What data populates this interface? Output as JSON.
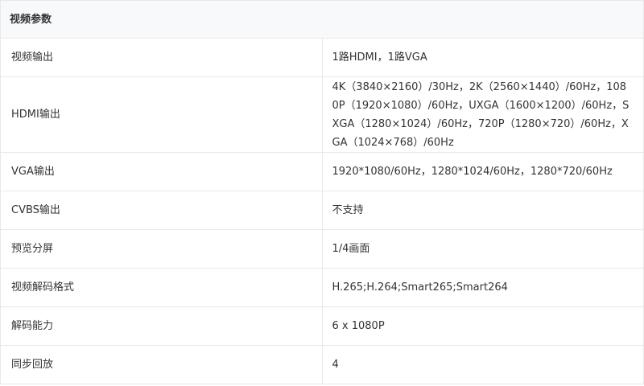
{
  "section": {
    "title": "视频参数"
  },
  "rows": [
    {
      "label": "视频输出",
      "value": "1路HDMI，1路VGA"
    },
    {
      "label": "HDMI输出",
      "value": "4K（3840×2160）/30Hz，2K（2560×1440）/60Hz，1080P（1920×1080）/60Hz，UXGA（1600×1200）/60Hz，SXGA（1280×1024）/60Hz，720P（1280×720）/60Hz，XGA（1024×768）/60Hz"
    },
    {
      "label": "VGA输出",
      "value": "1920*1080/60Hz，1280*1024/60Hz，1280*720/60Hz"
    },
    {
      "label": "CVBS输出",
      "value": "不支持"
    },
    {
      "label": "预览分屏",
      "value": "1/4画面"
    },
    {
      "label": "视频解码格式",
      "value": "H.265;H.264;Smart265;Smart264"
    },
    {
      "label": "解码能力",
      "value": "6 x 1080P"
    },
    {
      "label": "同步回放",
      "value": "4"
    }
  ]
}
